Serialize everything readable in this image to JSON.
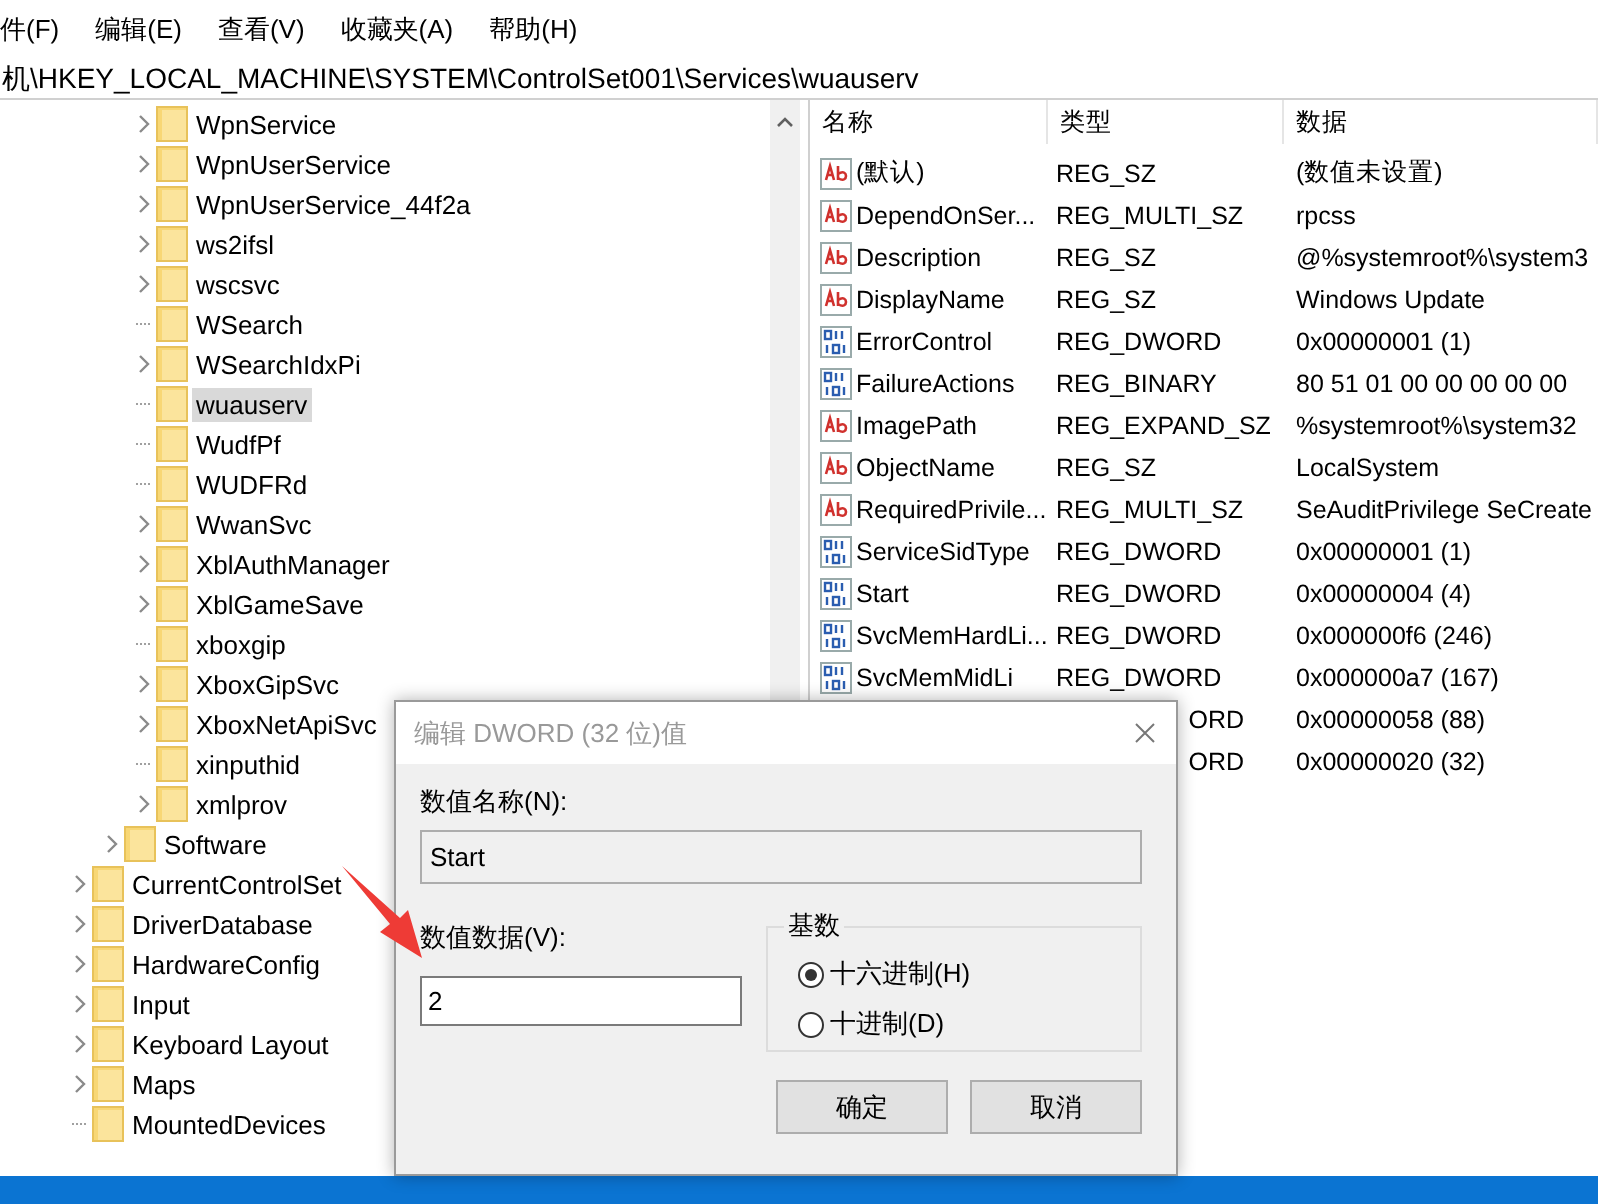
{
  "menu": [
    "件(F)",
    "编辑(E)",
    "查看(V)",
    "收藏夹(A)",
    "帮助(H)"
  ],
  "address": "机\\HKEY_LOCAL_MACHINE\\SYSTEM\\ControlSet001\\Services\\wuauserv",
  "tree": [
    {
      "children": [
        {
          "children": [
            {
              "label": "WpnService",
              "expandable": true,
              "selected": false
            },
            {
              "label": "WpnUserService",
              "expandable": true,
              "selected": false
            },
            {
              "label": "WpnUserService_44f2a",
              "expandable": true,
              "selected": false
            },
            {
              "label": "ws2ifsl",
              "expandable": true,
              "selected": false
            },
            {
              "label": "wscsvc",
              "expandable": true,
              "selected": false
            },
            {
              "label": "WSearch",
              "expandable": false,
              "selected": false
            },
            {
              "label": "WSearchIdxPi",
              "expandable": true,
              "selected": false
            },
            {
              "label": "wuauserv",
              "expandable": false,
              "selected": true
            },
            {
              "label": "WudfPf",
              "expandable": false,
              "selected": false
            },
            {
              "label": "WUDFRd",
              "expandable": false,
              "selected": false
            },
            {
              "label": "WwanSvc",
              "expandable": true,
              "selected": false
            },
            {
              "label": "XblAuthManager",
              "expandable": true,
              "selected": false
            },
            {
              "label": "XblGameSave",
              "expandable": true,
              "selected": false
            },
            {
              "label": "xboxgip",
              "expandable": false,
              "selected": false
            },
            {
              "label": "XboxGipSvc",
              "expandable": true,
              "selected": false
            },
            {
              "label": "XboxNetApiSvc",
              "expandable": true,
              "selected": false
            },
            {
              "label": "xinputhid",
              "expandable": false,
              "selected": false
            },
            {
              "label": "xmlprov",
              "expandable": true,
              "selected": false
            }
          ]
        },
        {
          "label": "Software",
          "expandable": true,
          "selected": false
        }
      ]
    },
    {
      "label": "CurrentControlSet",
      "expandable": true,
      "selected": false
    },
    {
      "label": "DriverDatabase",
      "expandable": true,
      "selected": false
    },
    {
      "label": "HardwareConfig",
      "expandable": true,
      "selected": false
    },
    {
      "label": "Input",
      "expandable": true,
      "selected": false
    },
    {
      "label": "Keyboard Layout",
      "expandable": true,
      "selected": false
    },
    {
      "label": "Maps",
      "expandable": true,
      "selected": false
    },
    {
      "label": "MountedDevices",
      "expandable": false,
      "selected": false
    }
  ],
  "values": {
    "columns": [
      "名称",
      "类型",
      "数据"
    ],
    "rows": [
      {
        "kind": "string",
        "name": "(默认)",
        "type": "REG_SZ",
        "data": "(数值未设置)"
      },
      {
        "kind": "string",
        "name": "DependOnSer...",
        "type": "REG_MULTI_SZ",
        "data": "rpcss"
      },
      {
        "kind": "string",
        "name": "Description",
        "type": "REG_SZ",
        "data": "@%systemroot%\\system3"
      },
      {
        "kind": "string",
        "name": "DisplayName",
        "type": "REG_SZ",
        "data": "Windows Update"
      },
      {
        "kind": "binary",
        "name": "ErrorControl",
        "type": "REG_DWORD",
        "data": "0x00000001 (1)"
      },
      {
        "kind": "binary",
        "name": "FailureActions",
        "type": "REG_BINARY",
        "data": "80 51 01 00 00 00 00 00"
      },
      {
        "kind": "string",
        "name": "ImagePath",
        "type": "REG_EXPAND_SZ",
        "data": "%systemroot%\\system32"
      },
      {
        "kind": "string",
        "name": "ObjectName",
        "type": "REG_SZ",
        "data": "LocalSystem"
      },
      {
        "kind": "string",
        "name": "RequiredPrivile...",
        "type": "REG_MULTI_SZ",
        "data": "SeAuditPrivilege SeCreate"
      },
      {
        "kind": "binary",
        "name": "ServiceSidType",
        "type": "REG_DWORD",
        "data": "0x00000001 (1)"
      },
      {
        "kind": "binary",
        "name": "Start",
        "type": "REG_DWORD",
        "data": "0x00000004 (4)"
      },
      {
        "kind": "binary",
        "name": "SvcMemHardLi...",
        "type": "REG_DWORD",
        "data": "0x000000f6 (246)"
      },
      {
        "kind": "binary",
        "name": "SvcMemMidLi",
        "type": "REG_DWORD",
        "data": "0x000000a7 (167)"
      },
      {
        "kind": "covered",
        "type": "ORD",
        "data": "0x00000058 (88)"
      },
      {
        "kind": "covered",
        "type": "ORD",
        "data": "0x00000020 (32)"
      }
    ]
  },
  "dialog": {
    "title": "编辑 DWORD (32 位)值",
    "name_label": "数值名称(N):",
    "name_value": "Start",
    "data_label": "数值数据(V):",
    "data_value": "2",
    "base_label": "基数",
    "bases": [
      {
        "label": "十六进制(H)",
        "selected": true
      },
      {
        "label": "十进制(D)",
        "selected": false
      }
    ],
    "buttons": [
      "确定",
      "取消"
    ]
  }
}
